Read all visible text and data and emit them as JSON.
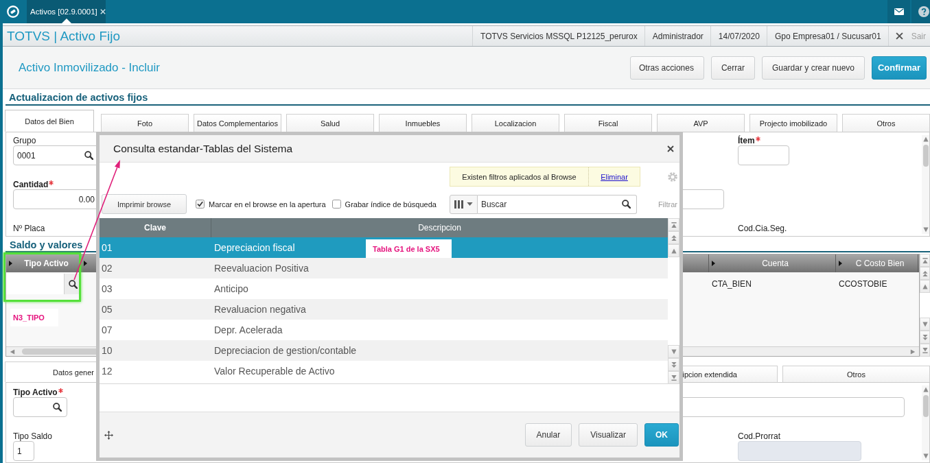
{
  "top_bar": {
    "tabs": [
      {
        "label": "Activos [02.9.0001]",
        "selected": true
      }
    ]
  },
  "header": {
    "title": "TOTVS | Activo Fijo",
    "info": [
      "TOTVS Servicios MSSQL P12125_perurox",
      "Administrador",
      "14/07/2020",
      "Gpo Empresa01 / Sucusar01"
    ],
    "exit": "Sair"
  },
  "action_bar": {
    "title": "Activo Inmovilizado - Incluir",
    "buttons": [
      {
        "label": "Otras acciones",
        "kind": "menu"
      },
      {
        "label": "Cerrar",
        "kind": "default"
      },
      {
        "label": "Guardar y crear nuevo",
        "kind": "default"
      },
      {
        "label": "Confirmar",
        "kind": "primary"
      }
    ]
  },
  "section": {
    "title": "Actualizacion de activos fijos",
    "tabs": [
      {
        "label": "Datos del Bien",
        "selected": true
      },
      {
        "label": "Foto",
        "selected": false
      },
      {
        "label": "Datos Complementarios",
        "selected": false
      },
      {
        "label": "Salud",
        "selected": false
      },
      {
        "label": "Inmuebles",
        "selected": false
      },
      {
        "label": "Localizacion",
        "selected": false
      },
      {
        "label": "Fiscal",
        "selected": false
      },
      {
        "label": "AVP",
        "selected": false
      },
      {
        "label": "Projecto imobilizado",
        "selected": false
      },
      {
        "label": "Otros",
        "selected": false
      }
    ],
    "form": {
      "left": [
        {
          "label": "Grupo",
          "required": false,
          "kind": "lookup",
          "value": "0001"
        },
        {
          "label": "Cantidad",
          "required": true,
          "kind": "number",
          "value": "0.00"
        },
        {
          "label": "Nº Placa",
          "required": false,
          "kind": "label"
        }
      ],
      "middle": [
        {
          "kind": "spacer"
        },
        {
          "kind": "text"
        }
      ],
      "right": [
        {
          "label": "Ítem",
          "required": true,
          "kind": "text"
        },
        {
          "kind": "spacer"
        },
        {
          "label": "Cod.Cia.Seg.",
          "required": false,
          "kind": "label"
        }
      ]
    }
  },
  "balances": {
    "title": "Saldo y valores",
    "columns": [
      {
        "label": "Tipo Activo",
        "required": true
      },
      {
        "label": "Cuenta",
        "required": false
      },
      {
        "label": "C Costo Bien",
        "required": false
      }
    ],
    "rows": [
      {
        "cells": [
          {
            "kind": "lookup"
          },
          {
            "kind": "text",
            "value": "CTA_BIEN"
          },
          {
            "kind": "text",
            "value": "CCOSTOBIE"
          }
        ]
      }
    ],
    "tabs": [
      {
        "label": "Datos gener",
        "selected": true
      },
      {
        "label": "ipcion extendida",
        "selected": false
      },
      {
        "label": "Otros",
        "selected": false
      }
    ],
    "form": {
      "left": [
        {
          "label": "Tipo Activo",
          "required": true,
          "kind": "lookup"
        },
        {
          "label": "Tipo Saldo",
          "required": false,
          "kind": "text",
          "value": "1"
        }
      ],
      "middle": [
        {
          "kind": "text"
        }
      ],
      "right": [
        {
          "kind": "spacer"
        },
        {
          "label": "Cod.Prorrat",
          "required": false,
          "kind": "disabled"
        }
      ]
    }
  },
  "dialog": {
    "title": "Consulta estandar-Tablas del Sistema",
    "notice": {
      "text": "Existen filtros aplicados al Browse",
      "link": "Eliminar"
    },
    "print_button": "Imprimir browse",
    "options": [
      {
        "label": "Marcar en el browse en la apertura",
        "checked": true
      },
      {
        "label": "Grabar índice de búsqueda",
        "checked": false
      }
    ],
    "search": {
      "placeholder": "Buscar"
    },
    "filter_button": "Filtrar",
    "table": {
      "columns": [
        "Clave",
        "Descripcion"
      ],
      "rows": [
        {
          "cells": [
            "01",
            "Depreciacion fiscal"
          ],
          "selected": true
        },
        {
          "cells": [
            "02",
            "Reevaluacion Positiva"
          ],
          "selected": false
        },
        {
          "cells": [
            "03",
            "Anticipo"
          ],
          "selected": false
        },
        {
          "cells": [
            "05",
            "Revaluacion negativa"
          ],
          "selected": false
        },
        {
          "cells": [
            "07",
            "Depr. Acelerada"
          ],
          "selected": false
        },
        {
          "cells": [
            "10",
            "Depreciacion de gestion/contable"
          ],
          "selected": false
        },
        {
          "cells": [
            "12",
            "Valor Recuperable de Activo"
          ],
          "selected": false
        }
      ]
    },
    "buttons": [
      {
        "label": "Anular",
        "kind": "default"
      },
      {
        "label": "Visualizar",
        "kind": "default"
      },
      {
        "label": "OK",
        "kind": "primary"
      }
    ]
  },
  "callouts": [
    {
      "kind": "table",
      "text": "Tabla G1 de la SX5"
    },
    {
      "kind": "field",
      "text": "N3_TIPO"
    }
  ]
}
